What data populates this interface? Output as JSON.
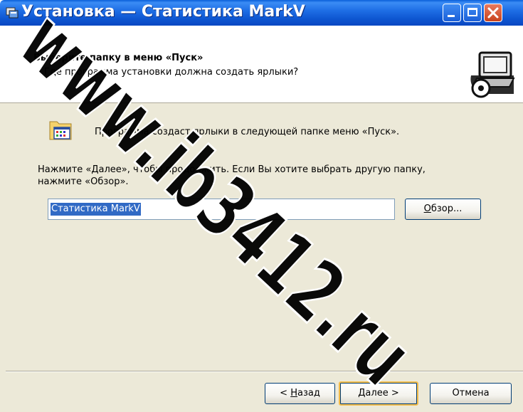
{
  "window": {
    "title": "Установка — Статистика MarkV",
    "controls": [
      "minimize",
      "maximize",
      "close"
    ]
  },
  "header": {
    "title": "Выберите папку в меню «Пуск»",
    "subtitle": "Где программа установки должна создать ярлыки?"
  },
  "content": {
    "info_text": "Программа создаст ярлыки в следующей папке меню «Пуск».",
    "instruction_line1": "Нажмите «Далее», чтобы продолжить. Если Вы хотите выбрать другую папку,",
    "instruction_line2": "нажмите «Обзор».",
    "folder_input_value": "Статистика MarkV"
  },
  "buttons": {
    "browse_accel": "О",
    "browse_rest": "бзор...",
    "back_prefix": "< ",
    "back_accel": "Н",
    "back_rest": "азад",
    "next_accel": "Д",
    "next_rest": "алее >",
    "cancel": "Отмена"
  },
  "watermark": {
    "text": "www.ib3412.ru",
    "color": "#000000"
  },
  "colors": {
    "titlebar": "#0a5fd9",
    "dialog_background": "#ece9d8",
    "selection": "#316ac5",
    "default_button_border": "#f5bd4a"
  },
  "icons": [
    "setup-app-icon",
    "computer-disk-logo-icon",
    "start-menu-folder-icon"
  ]
}
